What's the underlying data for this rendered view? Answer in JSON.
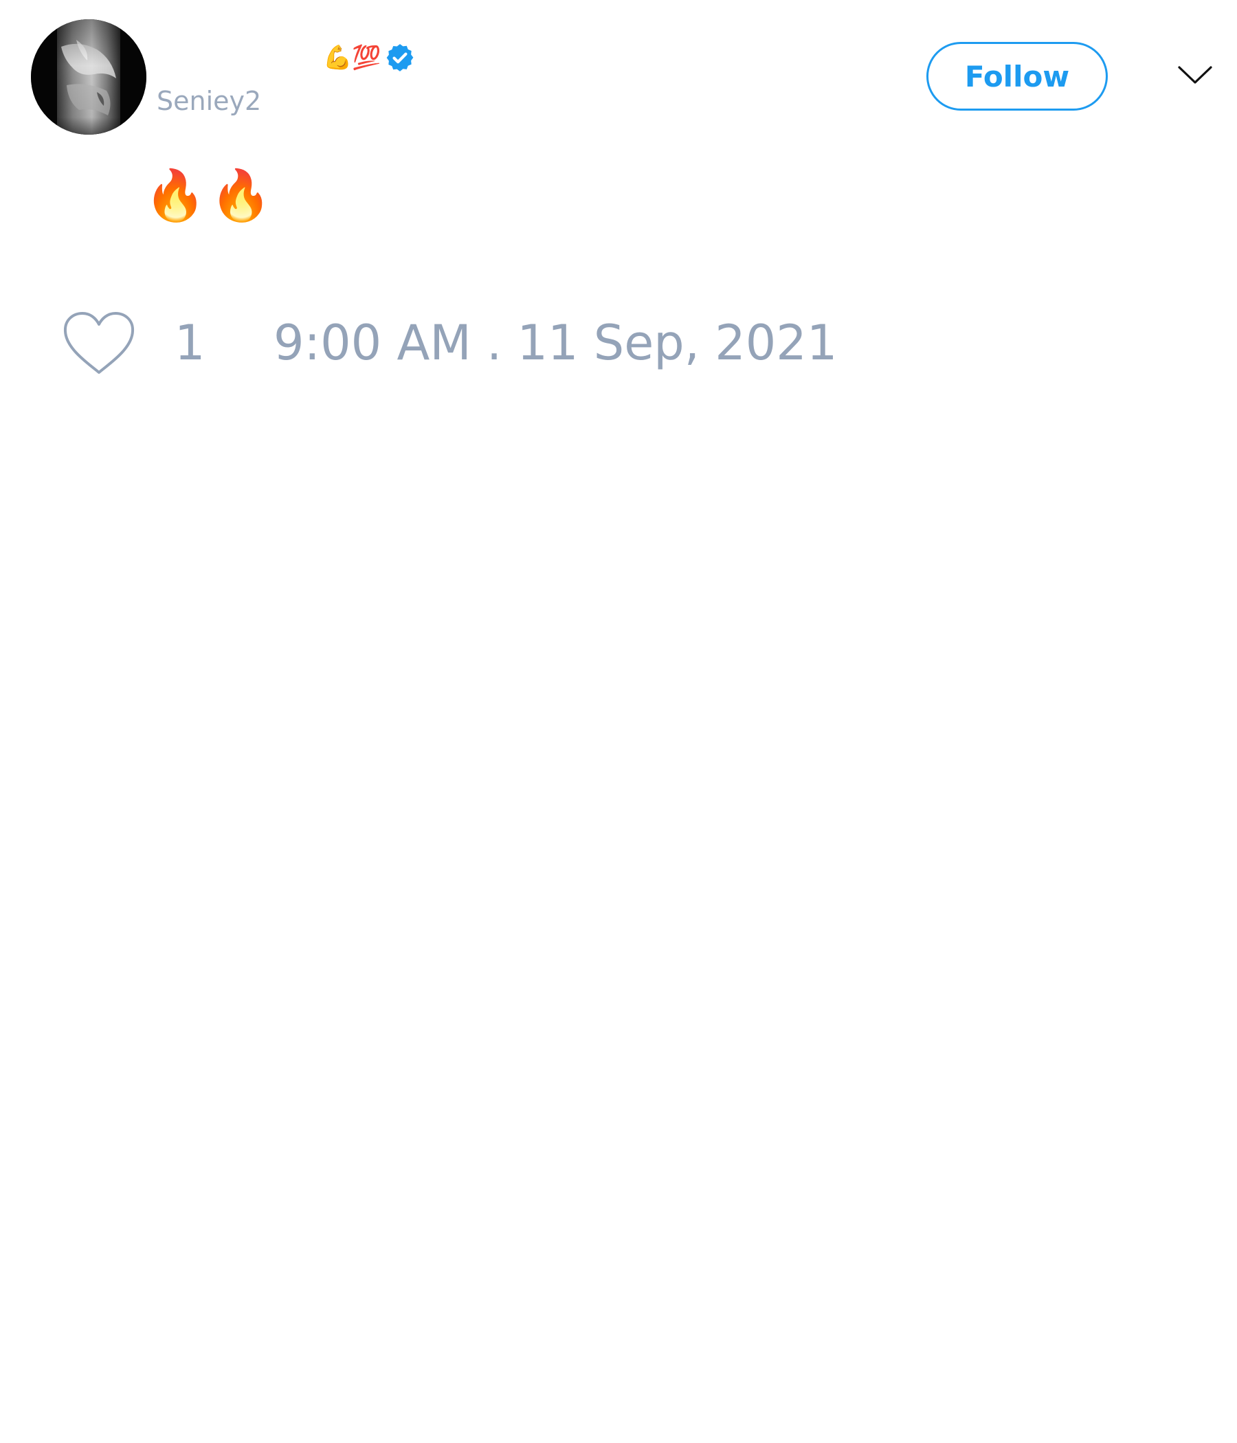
{
  "author": {
    "display_name_emoji": "💪💯",
    "verified": true,
    "handle": "Seniey2"
  },
  "header": {
    "follow_label": "Follow",
    "more_icon": "chevron-down-icon"
  },
  "tweet": {
    "text": "🔥🔥",
    "like_count": "1",
    "timestamp": "9:00 AM . 11 Sep, 2021"
  },
  "colors": {
    "accent": "#1d9bf0",
    "muted": "#94a3b8",
    "verified": "#1d9bf0"
  },
  "icons": {
    "like": "heart-outline-icon",
    "verified": "verified-badge-icon",
    "avatar": "profile-photo"
  }
}
